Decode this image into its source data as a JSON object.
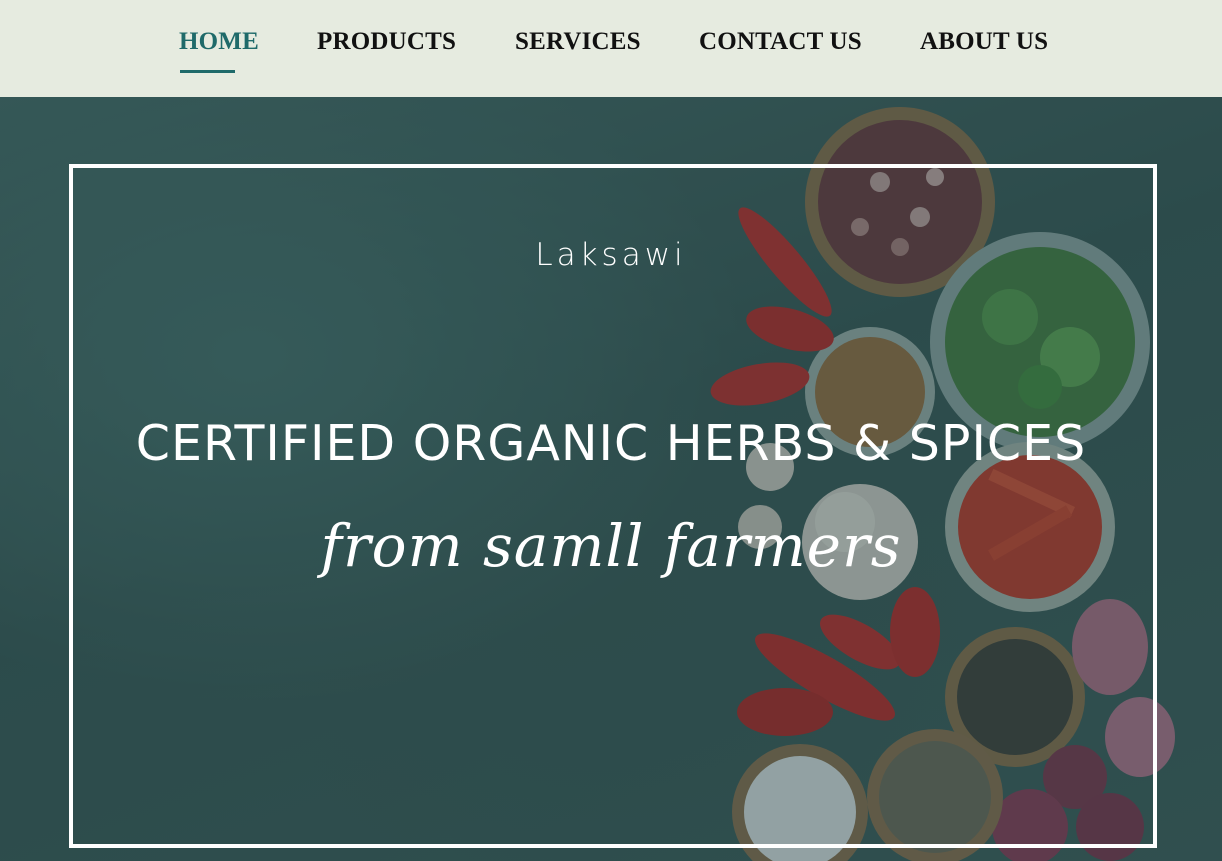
{
  "nav": {
    "items": [
      {
        "label": "HOME",
        "active": true
      },
      {
        "label": "PRODUCTS",
        "active": false
      },
      {
        "label": "SERVICES",
        "active": false
      },
      {
        "label": "CONTACT US",
        "active": false
      },
      {
        "label": "ABOUT US",
        "active": false
      }
    ]
  },
  "hero": {
    "brand": "Laksawi",
    "headline": "CERTIFIED ORGANIC HERBS & SPICES",
    "tagline": "from samll farmers"
  },
  "colors": {
    "nav_background": "#e6ebe0",
    "accent": "#1f6a6a",
    "hero_overlay": "#2f4f4f",
    "text_light": "#ffffff"
  }
}
